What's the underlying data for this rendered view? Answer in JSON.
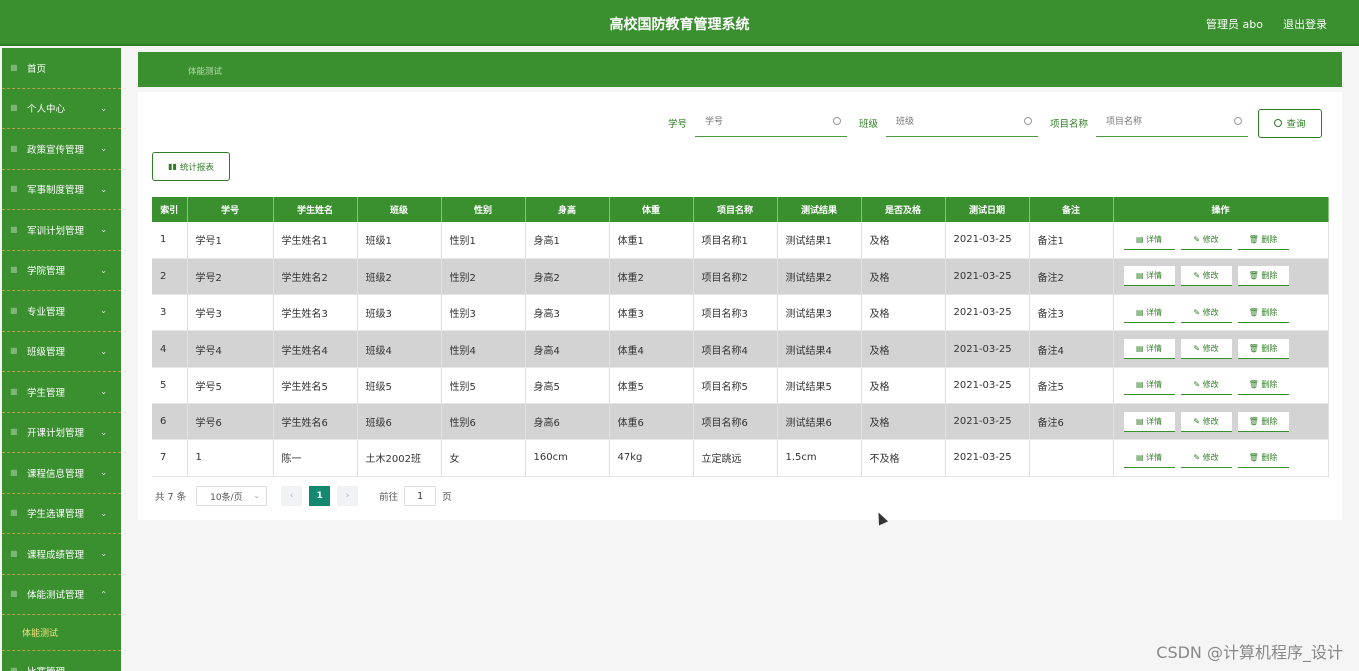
{
  "header": {
    "title": "高校国防教育管理系统",
    "user": "管理员 abo",
    "logout": "退出登录"
  },
  "sidebar": {
    "items": [
      {
        "label": "首页",
        "arrow": ""
      },
      {
        "label": "个人中心",
        "arrow": "⌄"
      },
      {
        "label": "政策宣传管理",
        "arrow": "⌄"
      },
      {
        "label": "军事制度管理",
        "arrow": "⌄"
      },
      {
        "label": "军训计划管理",
        "arrow": "⌄"
      },
      {
        "label": "学院管理",
        "arrow": "⌄"
      },
      {
        "label": "专业管理",
        "arrow": "⌄"
      },
      {
        "label": "班级管理",
        "arrow": "⌄"
      },
      {
        "label": "学生管理",
        "arrow": "⌄"
      },
      {
        "label": "开课计划管理",
        "arrow": "⌄"
      },
      {
        "label": "课程信息管理",
        "arrow": "⌄"
      },
      {
        "label": "学生选课管理",
        "arrow": "⌄"
      },
      {
        "label": "课程成绩管理",
        "arrow": "⌄"
      },
      {
        "label": "体能测试管理",
        "arrow": "⌃"
      }
    ],
    "submenu": "体能测试",
    "last_item": "比赛管理"
  },
  "breadcrumb": "体能测试",
  "search": {
    "fields": [
      {
        "label": "学号",
        "placeholder": "学号"
      },
      {
        "label": "班级",
        "placeholder": "班级"
      },
      {
        "label": "项目名称",
        "placeholder": "项目名称"
      }
    ],
    "query_label": "查询"
  },
  "stats_button": "统计报表",
  "table": {
    "headers": [
      "索引",
      "学号",
      "学生姓名",
      "班级",
      "性别",
      "身高",
      "体重",
      "项目名称",
      "测试结果",
      "是否及格",
      "测试日期",
      "备注",
      "操作"
    ],
    "rows": [
      [
        "1",
        "学号1",
        "学生姓名1",
        "班级1",
        "性别1",
        "身高1",
        "体重1",
        "项目名称1",
        "测试结果1",
        "及格",
        "2021-03-25",
        "备注1"
      ],
      [
        "2",
        "学号2",
        "学生姓名2",
        "班级2",
        "性别2",
        "身高2",
        "体重2",
        "项目名称2",
        "测试结果2",
        "及格",
        "2021-03-25",
        "备注2"
      ],
      [
        "3",
        "学号3",
        "学生姓名3",
        "班级3",
        "性别3",
        "身高3",
        "体重3",
        "项目名称3",
        "测试结果3",
        "及格",
        "2021-03-25",
        "备注3"
      ],
      [
        "4",
        "学号4",
        "学生姓名4",
        "班级4",
        "性别4",
        "身高4",
        "体重4",
        "项目名称4",
        "测试结果4",
        "及格",
        "2021-03-25",
        "备注4"
      ],
      [
        "5",
        "学号5",
        "学生姓名5",
        "班级5",
        "性别5",
        "身高5",
        "体重5",
        "项目名称5",
        "测试结果5",
        "及格",
        "2021-03-25",
        "备注5"
      ],
      [
        "6",
        "学号6",
        "学生姓名6",
        "班级6",
        "性别6",
        "身高6",
        "体重6",
        "项目名称6",
        "测试结果6",
        "及格",
        "2021-03-25",
        "备注6"
      ],
      [
        "7",
        "1",
        "陈一",
        "土木2002班",
        "女",
        "160cm",
        "47kg",
        "立定跳远",
        "1.5cm",
        "不及格",
        "2021-03-25",
        ""
      ]
    ],
    "actions": {
      "detail": "详情",
      "edit": "修改",
      "delete": "删除"
    }
  },
  "pagination": {
    "total": "共 7 条",
    "page_size": "10条/页",
    "prev": "‹",
    "current": "1",
    "next": "›",
    "goto_prefix": "前往",
    "goto_value": "1",
    "goto_suffix": "页"
  },
  "watermark": "CSDN @计算机程序_设计",
  "colors": {
    "primary": "#3a8f2f",
    "dark": "#2f7d25",
    "active_page": "#138a6f",
    "submenu_text": "#f3e27c"
  }
}
